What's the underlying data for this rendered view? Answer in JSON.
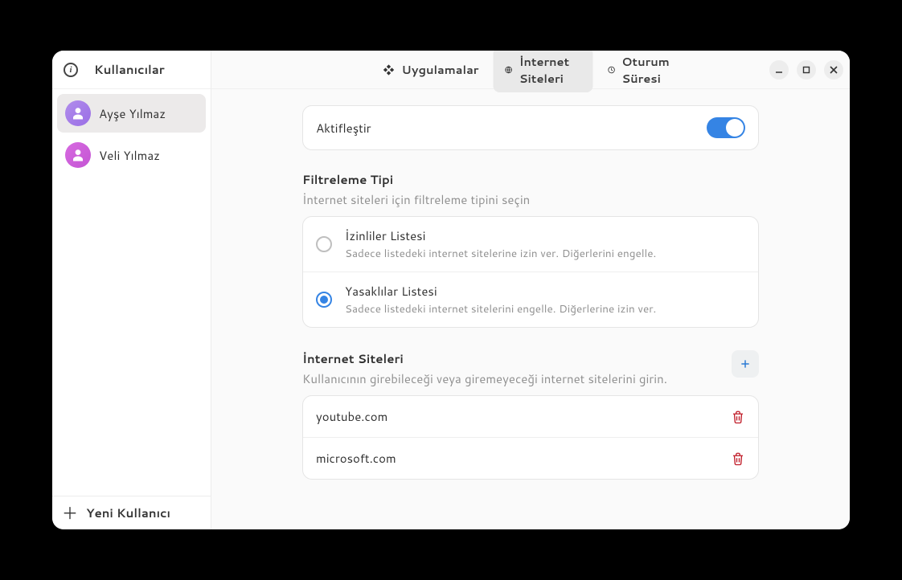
{
  "sidebar": {
    "title": "Kullanıcılar",
    "users": [
      {
        "name": "Ayşe Yılmaz",
        "avatar": "purple",
        "selected": true
      },
      {
        "name": "Veli Yılmaz",
        "avatar": "magenta",
        "selected": false
      }
    ],
    "new_user_label": "Yeni Kullanıcı"
  },
  "tabs": {
    "apps": "Uygulamalar",
    "websites": "İnternet Siteleri",
    "session": "Oturum Süresi",
    "active": "websites"
  },
  "enable": {
    "label": "Aktifleştir",
    "on": true
  },
  "filter": {
    "title": "Filtreleme Tipi",
    "subtitle": "İnternet siteleri için filtreleme tipini seçin",
    "options": [
      {
        "title": "İzinliler Listesi",
        "desc": "Sadece listedeki internet sitelerine izin ver. Diğerlerini engelle.",
        "checked": false
      },
      {
        "title": "Yasaklılar Listesi",
        "desc": "Sadece listedeki internet sitelerini engelle. Diğerlerine izin ver.",
        "checked": true
      }
    ]
  },
  "sites": {
    "title": "İnternet Siteleri",
    "subtitle": "Kullanıcının girebileceği veya giremeyeceği internet sitelerini girin.",
    "list": [
      "youtube.com",
      "microsoft.com"
    ]
  }
}
